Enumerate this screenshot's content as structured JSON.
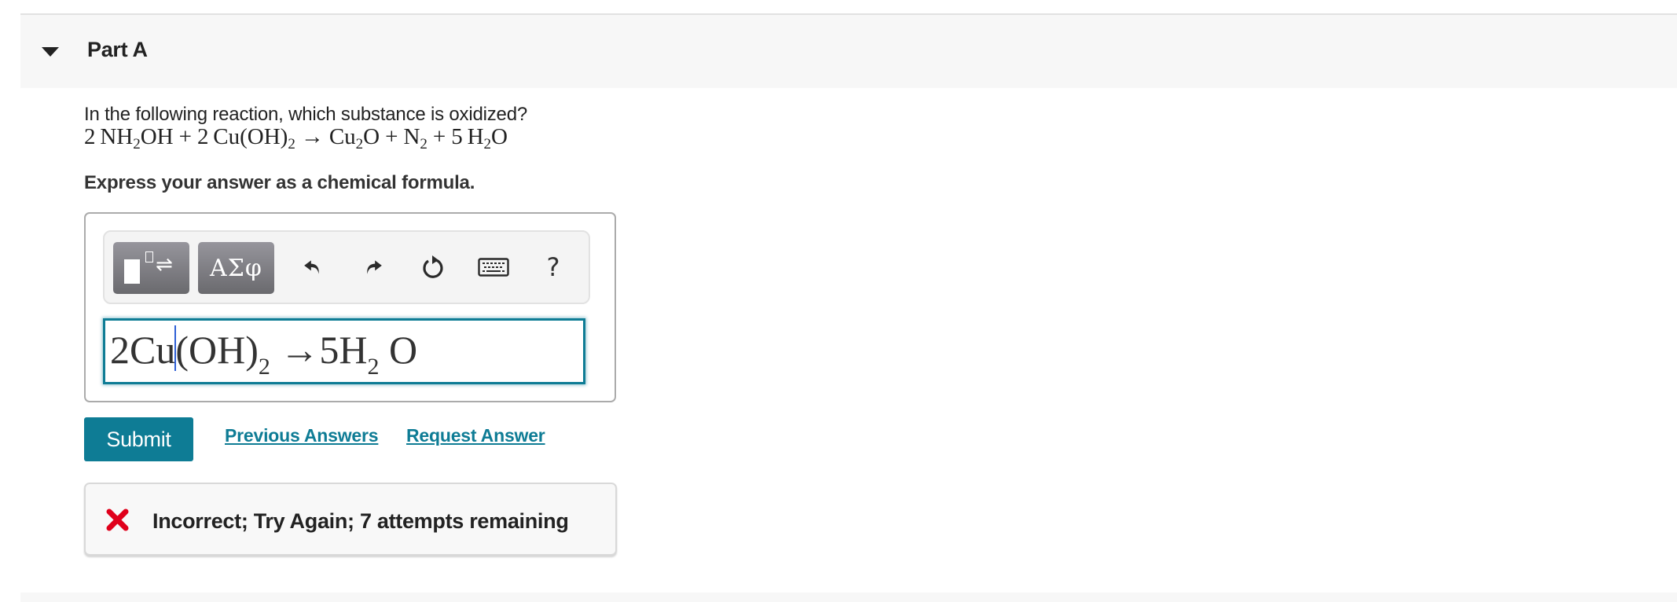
{
  "part": {
    "title": "Part A",
    "collapse_icon": "caret-down-icon"
  },
  "question": {
    "prompt": "In the following reaction, which substance is oxidized?",
    "equation": {
      "reactants": [
        {
          "coef": "2",
          "parts": [
            {
              "t": "NH"
            },
            {
              "sub": "2"
            },
            {
              "t": "OH"
            }
          ]
        },
        {
          "coef": "2",
          "parts": [
            {
              "t": "Cu(OH)"
            },
            {
              "sub": "2"
            }
          ]
        }
      ],
      "arrow": "→",
      "products": [
        {
          "coef": "",
          "parts": [
            {
              "t": "Cu"
            },
            {
              "sub": "2"
            },
            {
              "t": "O"
            }
          ]
        },
        {
          "coef": "",
          "parts": [
            {
              "t": "N"
            },
            {
              "sub": "2"
            }
          ]
        },
        {
          "coef": "5",
          "parts": [
            {
              "t": "H"
            },
            {
              "sub": "2"
            },
            {
              "t": "O"
            }
          ]
        }
      ],
      "plus": "+"
    },
    "instruction": "Express your answer as a chemical formula."
  },
  "toolbar": {
    "templates_button": "templates-icon",
    "symbols_label": "ΑΣφ",
    "undo": "undo-icon",
    "redo": "redo-icon",
    "reset": "reset-icon",
    "keyboard": "keyboard-icon",
    "help_label": "?"
  },
  "answer": {
    "before_cursor": "2Cu",
    "after_cursor_a": "(OH)",
    "sub_a": "2",
    "after_cursor_b": " →5H",
    "sub_b": "2",
    "after_cursor_c": " O"
  },
  "actions": {
    "submit_label": "Submit",
    "previous_answers_label": "Previous Answers",
    "request_answer_label": "Request Answer"
  },
  "feedback": {
    "status": "incorrect",
    "icon": "x-icon",
    "message": "Incorrect; Try Again; 7 attempts remaining"
  },
  "colors": {
    "accent": "#0e7c95",
    "error": "#e0001b",
    "header_bg": "#f7f7f7"
  }
}
